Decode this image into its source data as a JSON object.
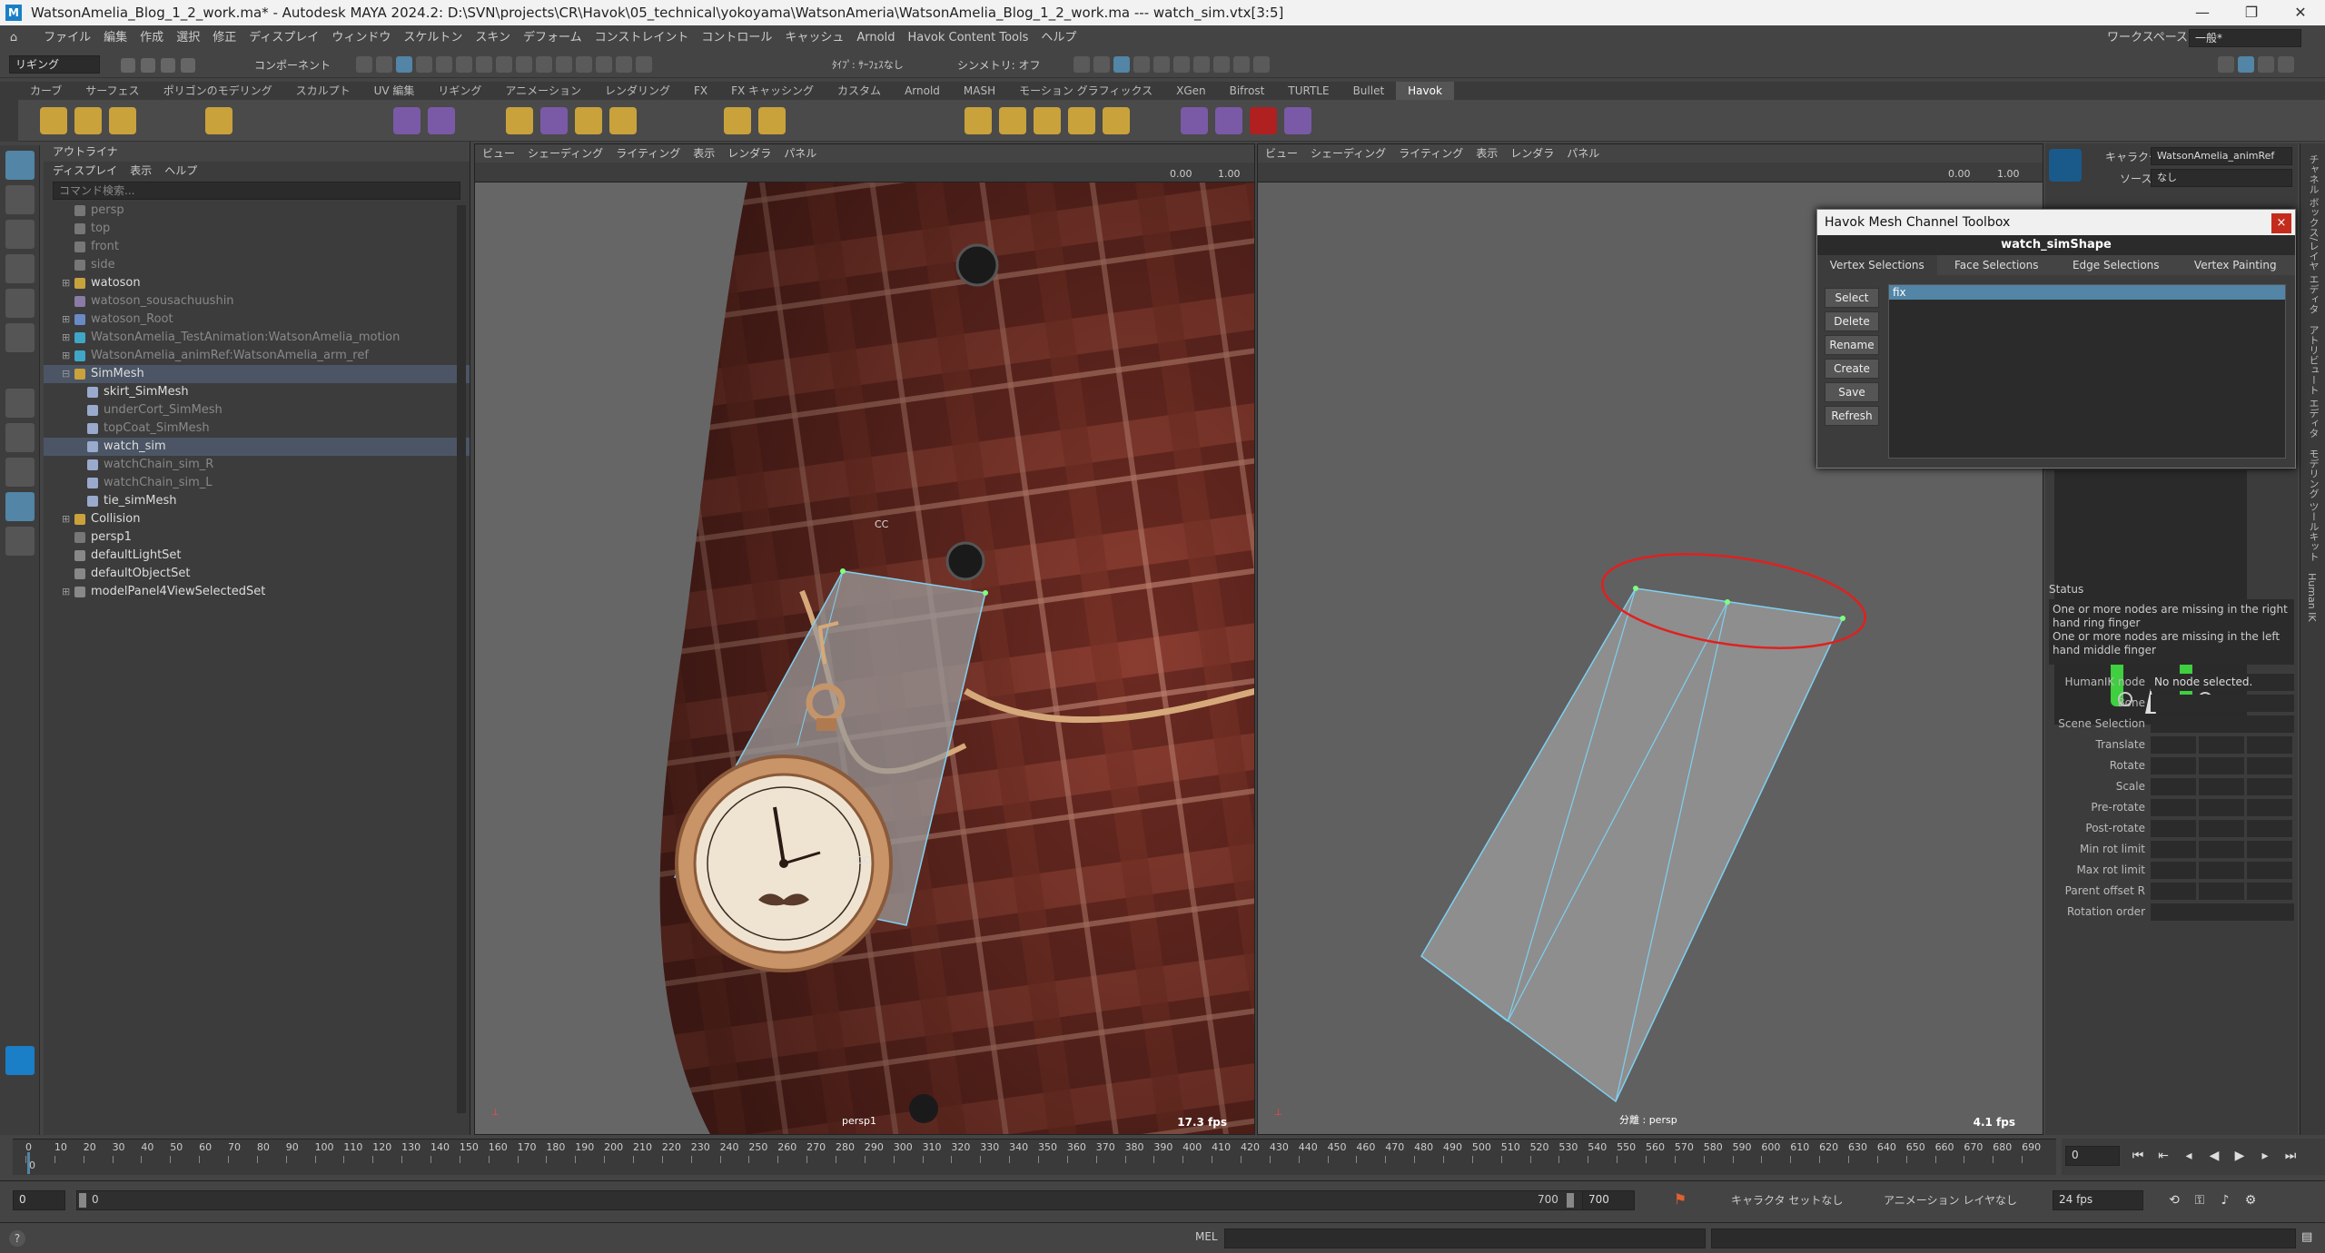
{
  "window": {
    "title": "WatsonAmelia_Blog_1_2_work.ma* - Autodesk MAYA 2024.2: D:\\SVN\\projects\\CR\\Havok\\05_technical\\yokoyama\\WatsonAmeria\\WatsonAmelia_Blog_1_2_work.ma  ---  watch_sim.vtx[3:5]",
    "logo": "M"
  },
  "menu": {
    "items": [
      "ファイル",
      "編集",
      "作成",
      "選択",
      "修正",
      "ディスプレイ",
      "ウィンドウ",
      "スケルトン",
      "スキン",
      "デフォーム",
      "コンストレイント",
      "コントロール",
      "キャッシュ",
      "Arnold",
      "Havok Content Tools",
      "ヘルプ"
    ],
    "workspace_label": "ワークスペース:",
    "workspace_value": "一般*"
  },
  "status_line": {
    "mode": "リギング",
    "component": "コンポーネント",
    "type_label": "ﾀｲﾌﾟ: ｻｰﾌｪｽなし",
    "symmetry": "シンメトリ: オフ"
  },
  "shelf": {
    "tabs": [
      "カーブ",
      "サーフェス",
      "ポリゴンのモデリング",
      "スカルプト",
      "UV 編集",
      "リギング",
      "アニメーション",
      "レンダリング",
      "FX",
      "FX キャッシング",
      "カスタム",
      "Arnold",
      "MASH",
      "モーション グラフィックス",
      "XGen",
      "Bifrost",
      "TURTLE",
      "Bullet",
      "Havok"
    ],
    "active_tab": "Havok"
  },
  "outliner": {
    "tab": "アウトライナ",
    "menu": [
      "ディスプレイ",
      "表示",
      "ヘルプ"
    ],
    "search_placeholder": "コマンド検索...",
    "rows": [
      {
        "label": "persp",
        "depth": 1,
        "dim": true,
        "icon": "camera-icon"
      },
      {
        "label": "top",
        "depth": 1,
        "dim": true,
        "icon": "camera-icon"
      },
      {
        "label": "front",
        "depth": 1,
        "dim": true,
        "icon": "camera-icon"
      },
      {
        "label": "side",
        "depth": 1,
        "dim": true,
        "icon": "camera-icon"
      },
      {
        "label": "watoson",
        "depth": 1,
        "exp": "⊞",
        "icon": "group-icon"
      },
      {
        "label": "watoson_sousachuushin",
        "depth": 1,
        "dim": true,
        "icon": "locator-icon"
      },
      {
        "label": "watoson_Root",
        "depth": 1,
        "exp": "⊞",
        "dim": true,
        "icon": "joint-icon"
      },
      {
        "label": "WatsonAmelia_TestAnimation:WatsonAmelia_motion",
        "depth": 1,
        "exp": "⊞",
        "dim": true,
        "icon": "asterisk-icon"
      },
      {
        "label": "WatsonAmelia_animRef:WatsonAmelia_arm_ref",
        "depth": 1,
        "exp": "⊞",
        "dim": true,
        "icon": "asterisk-icon"
      },
      {
        "label": "SimMesh",
        "depth": 1,
        "exp": "⊟",
        "sel": true,
        "icon": "group-icon"
      },
      {
        "label": "skirt_SimMesh",
        "depth": 2,
        "icon": "mesh-icon"
      },
      {
        "label": "underCort_SimMesh",
        "depth": 2,
        "dim": true,
        "icon": "mesh-icon"
      },
      {
        "label": "topCoat_SimMesh",
        "depth": 2,
        "dim": true,
        "icon": "mesh-icon"
      },
      {
        "label": "watch_sim",
        "depth": 2,
        "sel": true,
        "icon": "mesh-icon"
      },
      {
        "label": "watchChain_sim_R",
        "depth": 2,
        "dim": true,
        "icon": "mesh-icon"
      },
      {
        "label": "watchChain_sim_L",
        "depth": 2,
        "dim": true,
        "icon": "mesh-icon"
      },
      {
        "label": "tie_simMesh",
        "depth": 2,
        "icon": "mesh-icon"
      },
      {
        "label": "Collision",
        "depth": 1,
        "exp": "⊞",
        "icon": "group-icon"
      },
      {
        "label": "persp1",
        "depth": 1,
        "icon": "camera-icon"
      },
      {
        "label": "defaultLightSet",
        "depth": 1,
        "icon": "set-icon"
      },
      {
        "label": "defaultObjectSet",
        "depth": 1,
        "icon": "set-icon"
      },
      {
        "label": "modelPanel4ViewSelectedSet",
        "depth": 1,
        "exp": "⊞",
        "icon": "set-icon"
      }
    ]
  },
  "viewport_left": {
    "menu": [
      "ビュー",
      "シェーディング",
      "ライティング",
      "表示",
      "レンダラ",
      "パネル"
    ],
    "exposure": "0.00",
    "gamma": "1.00",
    "camera_label": "persp1",
    "fps": "17.3 fps",
    "cc_labels": [
      "CC",
      "CC",
      "CC"
    ]
  },
  "viewport_right": {
    "menu": [
      "ビュー",
      "シェーディング",
      "ライティング",
      "表示",
      "レンダラ",
      "パネル"
    ],
    "exposure": "0.00",
    "gamma": "1.00",
    "camera_label": "分離 : persp",
    "fps": "4.1 fps"
  },
  "havok_toolbox": {
    "title": "Havok Mesh Channel Toolbox",
    "close": "×",
    "mesh": "watch_simShape",
    "tabs": [
      "Vertex Selections",
      "Face Selections",
      "Edge Selections",
      "Vertex Painting"
    ],
    "active_tab": "Vertex Selections",
    "buttons": [
      "Select",
      "Delete",
      "Rename",
      "Create",
      "Save",
      "Refresh"
    ],
    "items": [
      "fix"
    ]
  },
  "humanik": {
    "character_label": "キャラクタ:",
    "character_value": "WatsonAmelia_animRef",
    "source_label": "ソース:",
    "source_value": "なし",
    "status_label": "Status",
    "status_text": "One or more nodes are missing in the right hand ring finger\nOne or more nodes are missing in the left hand middle finger",
    "node_label": "HumanIK node",
    "node_value": "No node selected.",
    "props": [
      "Bone",
      "Scene Selection",
      "Translate",
      "Rotate",
      "Scale",
      "Pre-rotate",
      "Post-rotate",
      "Min rot limit",
      "Max rot limit",
      "Parent offset R",
      "Rotation order"
    ]
  },
  "side_tabs": [
    "チャネル ボックス/レイヤ エディタ",
    "アトリビュート エディタ",
    "モデリング ツールキット",
    "Human IK"
  ],
  "timeline": {
    "ticks": [
      "0",
      "10",
      "20",
      "30",
      "40",
      "50",
      "60",
      "70",
      "80",
      "90",
      "100",
      "110",
      "120",
      "130",
      "140",
      "150",
      "160",
      "170",
      "180",
      "190",
      "200",
      "210",
      "220",
      "230",
      "240",
      "250",
      "260",
      "270",
      "280",
      "290",
      "300",
      "310",
      "320",
      "330",
      "340",
      "350",
      "360",
      "370",
      "380",
      "390",
      "400",
      "410",
      "420",
      "430",
      "440",
      "450",
      "460",
      "470",
      "480",
      "490",
      "500",
      "510",
      "520",
      "530",
      "540",
      "550",
      "560",
      "570",
      "580",
      "590",
      "600",
      "610",
      "620",
      "630",
      "640",
      "650",
      "660",
      "670",
      "680",
      "690"
    ],
    "current_frame": "0",
    "current_field": "0"
  },
  "range": {
    "start": "0",
    "inner_start": "0",
    "inner_end": "700",
    "end": "700",
    "character_set": "キャラクタ セットなし",
    "anim_layer": "アニメーション レイヤなし",
    "fps": "24 fps"
  },
  "command": {
    "lang": "MEL",
    "help": "?"
  },
  "colors": {
    "accent": "#5285a6",
    "selection_ring": "#e02020",
    "mesh_edge": "#7fd0f0"
  }
}
